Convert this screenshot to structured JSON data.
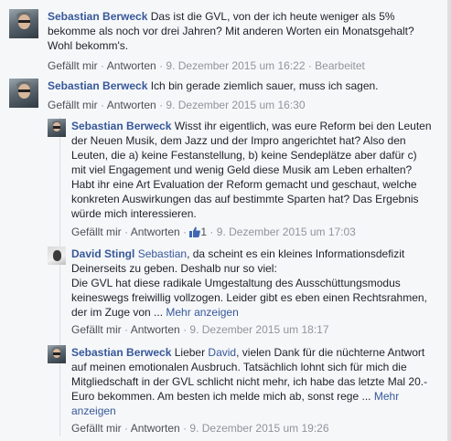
{
  "comments": [
    {
      "author": "Sebastian Berweck",
      "text": " Das ist die GVL, von der ich heute weniger als 5% bekomme als noch vor drei Jahren? Mit anderen Worten ein Monatsgehalt? Wohl bekomm's.",
      "like": "Gefällt mir",
      "reply": "Antworten",
      "time": "9. Dezember 2015 um 16:22",
      "edited": "Bearbeitet"
    },
    {
      "author": "Sebastian Berweck",
      "text": " Ich bin gerade ziemlich sauer, muss ich sagen.",
      "like": "Gefällt mir",
      "reply": "Antworten",
      "time": "9. Dezember 2015 um 16:30"
    }
  ],
  "replies": [
    {
      "author": "Sebastian Berweck",
      "text": " Wisst ihr eigentlich, was eure Reform bei den Leuten der Neuen Musik, dem Jazz und der Impro angerichtet hat? Also den Leuten, die a) keine Festanstellung, b) keine Sendeplätze aber dafür c) mit viel Engagement und wenig Geld diese Musik am Leben erhalten? Habt ihr eine Art Evaluation der Reform gemacht und geschaut, welche konkreten Auswirkungen das auf bestimmte Sparten hat? Das Ergebnis würde mich interessieren.",
      "like": "Gefällt mir",
      "reply": "Antworten",
      "like_count": "1",
      "time": "9. Dezember 2015 um 17:03"
    },
    {
      "author": "David Stingl",
      "mention": "Sebastian",
      "text_line1": ", da scheint es ein kleines Informationsdefizit Deinerseits zu geben. Deshalb nur so viel:",
      "text_line2": "Die GVL hat diese radikale Umgestaltung des Ausschüttungsmodus keineswegs freiwillig vollzogen. Leider gibt es eben einen Rechtsrahmen, der im Zuge von ...",
      "more": "Mehr anzeigen",
      "like": "Gefällt mir",
      "reply": "Antworten",
      "time": "9. Dezember 2015 um 18:17"
    },
    {
      "author": "Sebastian Berweck",
      "text_before": " Lieber ",
      "mention": "David",
      "text": ", vielen Dank für die nüchterne Antwort auf meinen emotionalen Ausbruch. Tatsächlich lohnt sich für mich die Mitgliedschaft in der GVL schlicht nicht mehr, ich habe das letzte Mal 20.- Euro bekommen. Am besten ich melde mich ab, sonst rege ...",
      "more": "Mehr anzeigen",
      "like": "Gefällt mir",
      "reply": "Antworten",
      "time": "9. Dezember 2015 um 19:26"
    }
  ],
  "separator": " · ",
  "colors": {
    "link": "#365899",
    "meta": "#90949c",
    "background": "#f6f7f9"
  },
  "icons": [
    "avatar-sebastian",
    "avatar-david",
    "thumbs-up-icon"
  ]
}
